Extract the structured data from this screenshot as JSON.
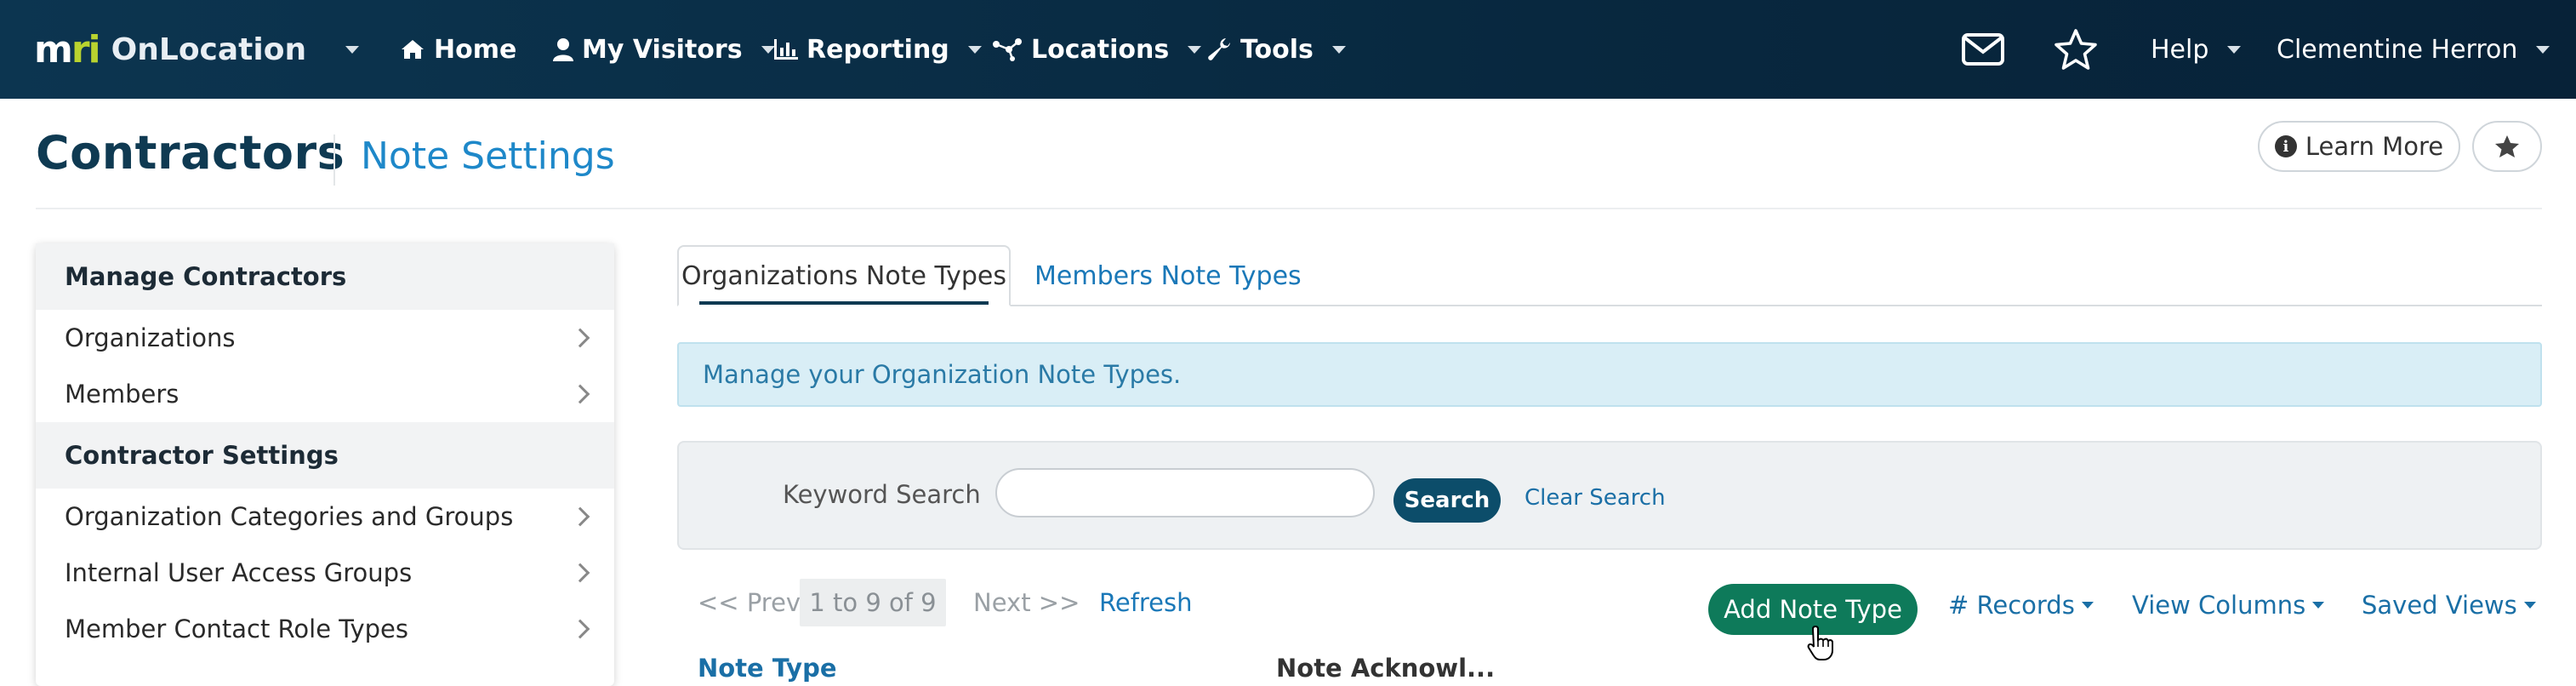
{
  "navbar": {
    "logo_mark_m": "m",
    "logo_mark_ri": "ri",
    "brand": "OnLocation",
    "items": [
      {
        "label": "Home",
        "icon": "home-icon"
      },
      {
        "label": "My Visitors",
        "icon": "user-icon"
      },
      {
        "label": "Reporting",
        "icon": "bar-chart-icon"
      },
      {
        "label": "Locations",
        "icon": "network-icon"
      },
      {
        "label": "Tools",
        "icon": "wrench-icon"
      }
    ],
    "help": "Help",
    "user": "Clementine Herron"
  },
  "header": {
    "title": "Contractors",
    "subtitle": "Note Settings",
    "learn_more": "Learn More",
    "info_glyph": "i"
  },
  "sidebar": {
    "sections": [
      {
        "heading": "Manage Contractors",
        "items": [
          "Organizations",
          "Members"
        ]
      },
      {
        "heading": "Contractor Settings",
        "items": [
          "Organization Categories and Groups",
          "Internal User Access Groups",
          "Member Contact Role Types"
        ]
      }
    ]
  },
  "tabs": {
    "active": "Organizations Note Types",
    "other": "Members Note Types"
  },
  "alert": "Manage your Organization Note Types.",
  "search": {
    "label": "Keyword Search",
    "value": "",
    "button": "Search",
    "clear": "Clear Search"
  },
  "pager": {
    "prev": "<< Prev",
    "range": "1 to 9 of 9",
    "next": "Next >>",
    "refresh": "Refresh"
  },
  "toolbar": {
    "add": "Add Note Type",
    "records": "# Records",
    "view_columns": "View Columns",
    "saved_views": "Saved Views"
  },
  "table": {
    "headers": [
      "Note Type",
      "Note Acknowl..."
    ]
  },
  "colors": {
    "navbar": "#0c3550",
    "accent_green": "#0e7a5a",
    "link_blue": "#1a78b8",
    "logo_green": "#b9d32f"
  }
}
